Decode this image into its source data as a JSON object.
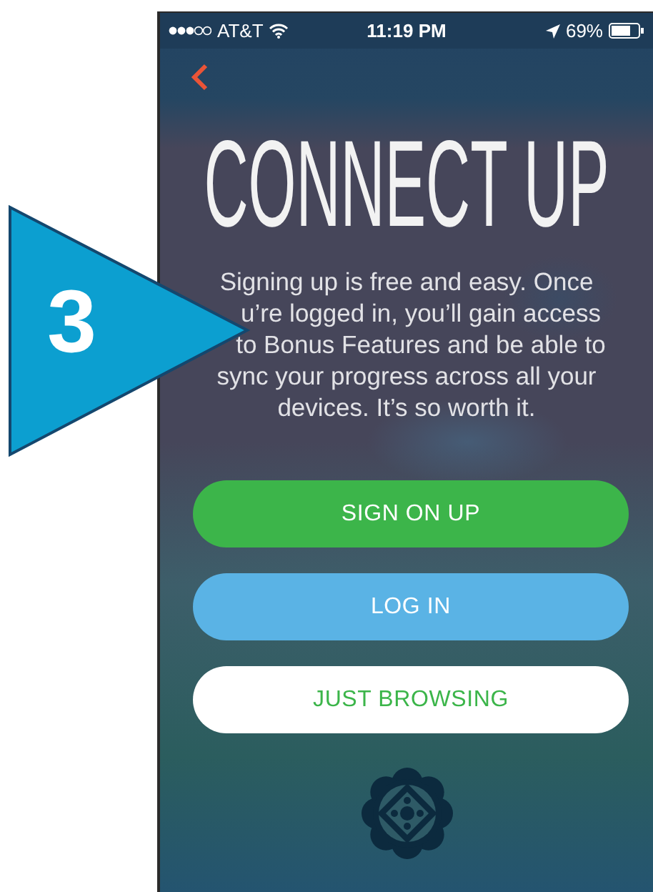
{
  "status_bar": {
    "carrier": "AT&T",
    "time": "11:19 PM",
    "battery": "69%"
  },
  "title": "CONNECT UP",
  "description_lines": [
    "Signing up is free and easy. Once",
    "u’re logged in, you’ll gain access",
    "to Bonus Features and be able to",
    "sync your progress across all your",
    "devices. It’s so worth it."
  ],
  "buttons": [
    {
      "label": "SIGN ON UP",
      "kind": "primary"
    },
    {
      "label": "LOG IN",
      "kind": "secondary"
    },
    {
      "label": "JUST BROWSING",
      "kind": "plain"
    }
  ],
  "annotation": {
    "number": "3"
  }
}
